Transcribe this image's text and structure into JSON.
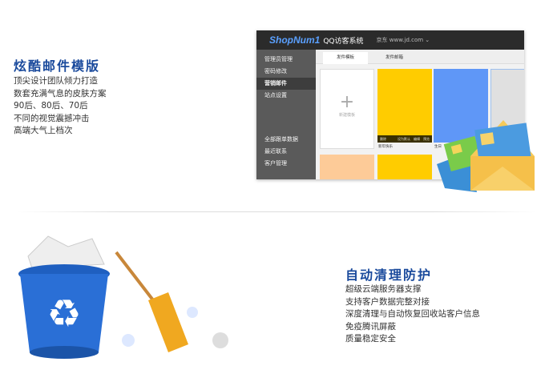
{
  "section1": {
    "title": "炫酷邮件模版",
    "lines": [
      "顶尖设计团队倾力打造",
      "数套充满气息的皮肤方案",
      "90后、80后、70后",
      "不同的视觉震撼冲击",
      "高端大气上档次"
    ]
  },
  "screenshot": {
    "logo": "ShopNum1",
    "system": "QQ访客系统",
    "store": "京东 www.jd.com ⌄",
    "sidebar": [
      "管理员管理",
      "密码修改",
      "营销邮件",
      "站点设置",
      "全部跟单数据",
      "最近联系",
      "客户管理"
    ],
    "tabs": [
      "发件模板",
      "发件邮箱"
    ],
    "new_template": "新建模板",
    "card_actions": [
      "删除",
      "设为默认",
      "编辑",
      "预览"
    ],
    "card_names": [
      "新年快乐",
      "生日"
    ],
    "colors": {
      "yellow": "#ffcc00",
      "blue": "#5f97f7",
      "peach": "#fdcb98",
      "gray": "#e0e0e0"
    }
  },
  "section2": {
    "title": "自动清理防护",
    "lines": [
      "超级云端服务器支撑",
      "支持客户数据完整对接",
      "深度清理与自动恢复回收站客户信息",
      "免疫腾讯屏蔽",
      "质量稳定安全"
    ]
  }
}
